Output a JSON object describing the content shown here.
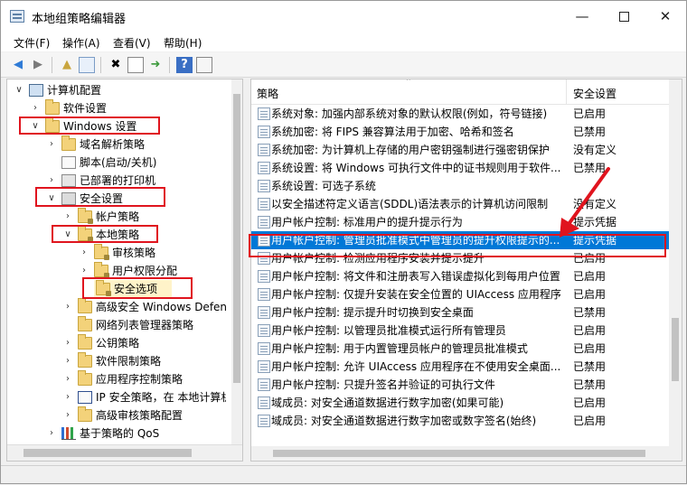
{
  "window": {
    "title": "本地组策略编辑器"
  },
  "menu": [
    "文件(F)",
    "操作(A)",
    "查看(V)",
    "帮助(H)"
  ],
  "toolbar_icons": [
    "back-icon",
    "forward-icon",
    "up-folder-icon",
    "show-tree-icon",
    "delete-icon",
    "properties-icon",
    "export-icon",
    "help-icon",
    "filter-icon"
  ],
  "tree": {
    "root": "计算机配置",
    "items": [
      "软件设置",
      "Windows 设置",
      "域名解析策略",
      "脚本(启动/关机)",
      "已部署的打印机",
      "安全设置",
      "帐户策略",
      "本地策略",
      "审核策略",
      "用户权限分配",
      "安全选项",
      "高级安全 Windows Defender",
      "网络列表管理器策略",
      "公钥策略",
      "软件限制策略",
      "应用程序控制策略",
      "IP 安全策略，在 本地计算机",
      "高级审核策略配置",
      "基于策略的 QoS"
    ]
  },
  "list": {
    "headers": {
      "policy": "策略",
      "setting": "安全设置"
    },
    "rows": [
      {
        "policy": "系统对象: 加强内部系统对象的默认权限(例如，符号链接)",
        "setting": "已启用"
      },
      {
        "policy": "系统加密: 将 FIPS 兼容算法用于加密、哈希和签名",
        "setting": "已禁用"
      },
      {
        "policy": "系统加密: 为计算机上存储的用户密钥强制进行强密钥保护",
        "setting": "没有定义"
      },
      {
        "policy": "系统设置: 将 Windows 可执行文件中的证书规则用于软件...",
        "setting": "已禁用"
      },
      {
        "policy": "系统设置: 可选子系统",
        "setting": ""
      },
      {
        "policy": "以安全描述符定义语言(SDDL)语法表示的计算机访问限制",
        "setting": "没有定义"
      },
      {
        "policy": "用户帐户控制: 标准用户的提升提示行为",
        "setting": "提示凭据"
      },
      {
        "policy": "用户帐户控制: 管理员批准模式中管理员的提升权限提示的...",
        "setting": "提示凭据"
      },
      {
        "policy": "用户帐户控制: 检测应用程序安装并提示提升",
        "setting": "已启用"
      },
      {
        "policy": "用户帐户控制: 将文件和注册表写入错误虚拟化到每用户位置",
        "setting": "已启用"
      },
      {
        "policy": "用户帐户控制: 仅提升安装在安全位置的 UIAccess 应用程序",
        "setting": "已启用"
      },
      {
        "policy": "用户帐户控制: 提示提升时切换到安全桌面",
        "setting": "已禁用"
      },
      {
        "policy": "用户帐户控制: 以管理员批准模式运行所有管理员",
        "setting": "已启用"
      },
      {
        "policy": "用户帐户控制: 用于内置管理员帐户的管理员批准模式",
        "setting": "已启用"
      },
      {
        "policy": "用户帐户控制: 允许 UIAccess 应用程序在不使用安全桌面...",
        "setting": "已禁用"
      },
      {
        "policy": "用户帐户控制: 只提升签名并验证的可执行文件",
        "setting": "已禁用"
      },
      {
        "policy": "域成员: 对安全通道数据进行数字加密(如果可能)",
        "setting": "已启用"
      },
      {
        "policy": "域成员: 对安全通道数据进行数字加密或数字签名(始终)",
        "setting": "已启用"
      }
    ]
  },
  "colors": {
    "selection": "#0078d7",
    "annotation": "#e0141e"
  }
}
